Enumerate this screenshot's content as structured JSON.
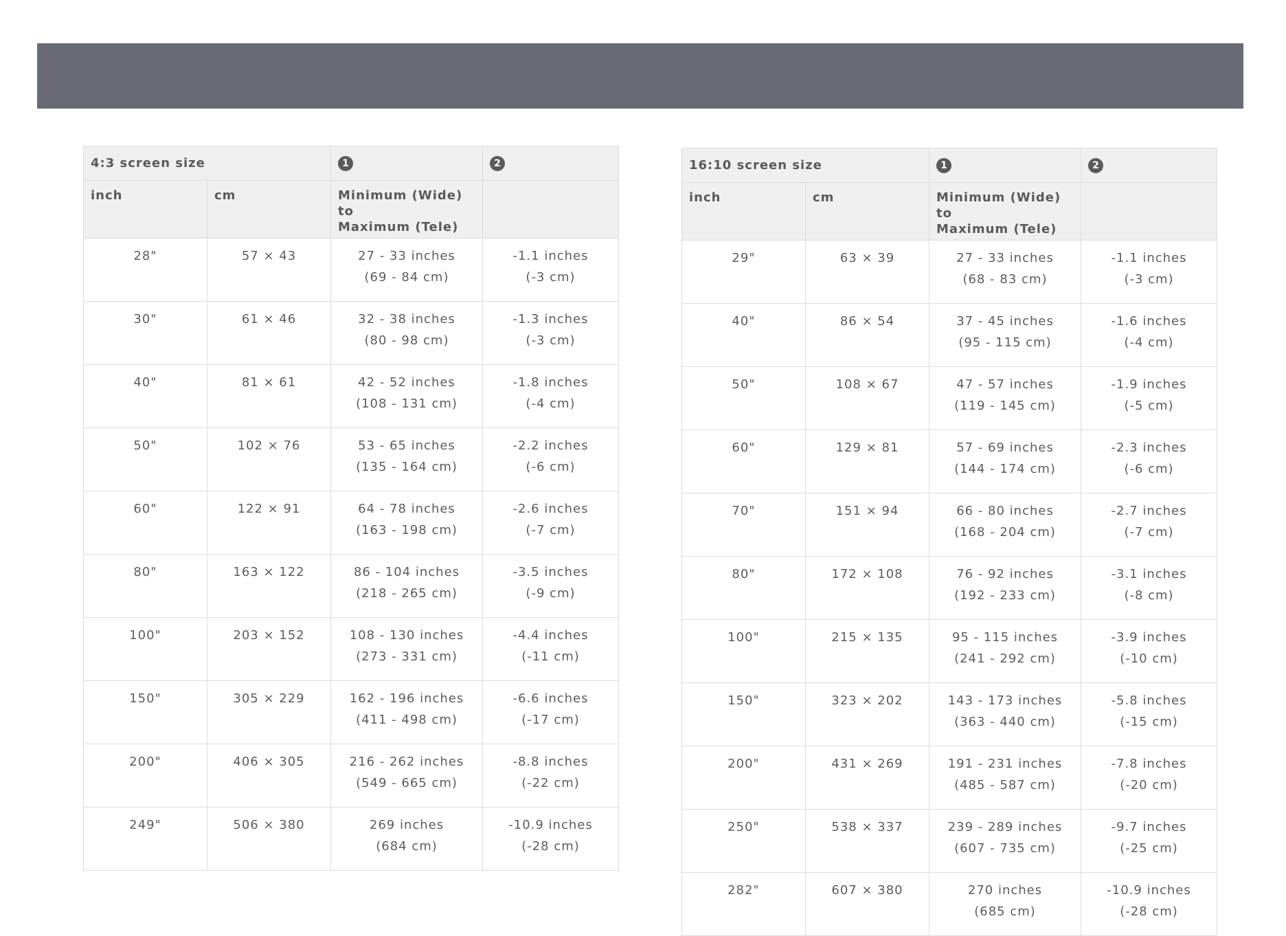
{
  "tables": [
    {
      "title": "4:3 screen size",
      "icons": {
        "col3": "1",
        "col4": "2"
      },
      "col_inch": "inch",
      "col_cm": "cm",
      "col_range_line1": "Minimum (Wide) to",
      "col_range_line2": "Maximum (Tele)",
      "rows": [
        {
          "inch": "28\"",
          "cm": "57 × 43",
          "range": "27 - 33 inches",
          "range_cm": "(69 - 84 cm)",
          "offset": "-1.1 inches",
          "offset_cm": "(-3 cm)"
        },
        {
          "inch": "30\"",
          "cm": "61 × 46",
          "range": "32 - 38 inches",
          "range_cm": "(80 - 98 cm)",
          "offset": "-1.3 inches",
          "offset_cm": "(-3 cm)"
        },
        {
          "inch": "40\"",
          "cm": "81 × 61",
          "range": "42 - 52 inches",
          "range_cm": "(108 - 131 cm)",
          "offset": "-1.8 inches",
          "offset_cm": "(-4 cm)"
        },
        {
          "inch": "50\"",
          "cm": "102 × 76",
          "range": "53 - 65 inches",
          "range_cm": "(135 - 164 cm)",
          "offset": "-2.2 inches",
          "offset_cm": "(-6 cm)"
        },
        {
          "inch": "60\"",
          "cm": "122 × 91",
          "range": "64 - 78 inches",
          "range_cm": "(163 - 198 cm)",
          "offset": "-2.6 inches",
          "offset_cm": "(-7 cm)"
        },
        {
          "inch": "80\"",
          "cm": "163 × 122",
          "range": "86 - 104 inches",
          "range_cm": "(218 - 265 cm)",
          "offset": "-3.5 inches",
          "offset_cm": "(-9 cm)"
        },
        {
          "inch": "100\"",
          "cm": "203 × 152",
          "range": "108 - 130 inches",
          "range_cm": "(273 - 331 cm)",
          "offset": "-4.4 inches",
          "offset_cm": "(-11 cm)"
        },
        {
          "inch": "150\"",
          "cm": "305 × 229",
          "range": "162 - 196 inches",
          "range_cm": "(411 - 498 cm)",
          "offset": "-6.6 inches",
          "offset_cm": "(-17 cm)"
        },
        {
          "inch": "200\"",
          "cm": "406 × 305",
          "range": "216 - 262 inches",
          "range_cm": "(549 - 665 cm)",
          "offset": "-8.8 inches",
          "offset_cm": "(-22 cm)"
        },
        {
          "inch": "249\"",
          "cm": "506 × 380",
          "range": "269 inches",
          "range_cm": "(684 cm)",
          "offset": "-10.9 inches",
          "offset_cm": "(-28 cm)"
        }
      ]
    },
    {
      "title": "16:10 screen size",
      "icons": {
        "col3": "1",
        "col4": "2"
      },
      "col_inch": "inch",
      "col_cm": "cm",
      "col_range_line1": "Minimum (Wide) to",
      "col_range_line2": "Maximum (Tele)",
      "rows": [
        {
          "inch": "29\"",
          "cm": "63 × 39",
          "range": "27 - 33 inches",
          "range_cm": "(68 - 83 cm)",
          "offset": "-1.1 inches",
          "offset_cm": "(-3 cm)"
        },
        {
          "inch": "40\"",
          "cm": "86 × 54",
          "range": "37 - 45 inches",
          "range_cm": "(95 - 115 cm)",
          "offset": "-1.6 inches",
          "offset_cm": "(-4 cm)"
        },
        {
          "inch": "50\"",
          "cm": "108 × 67",
          "range": "47 - 57 inches",
          "range_cm": "(119 - 145 cm)",
          "offset": "-1.9 inches",
          "offset_cm": "(-5 cm)"
        },
        {
          "inch": "60\"",
          "cm": "129 × 81",
          "range": "57 - 69 inches",
          "range_cm": "(144 - 174 cm)",
          "offset": "-2.3 inches",
          "offset_cm": "(-6 cm)"
        },
        {
          "inch": "70\"",
          "cm": "151 × 94",
          "range": "66 - 80 inches",
          "range_cm": "(168 - 204 cm)",
          "offset": "-2.7 inches",
          "offset_cm": "(-7 cm)"
        },
        {
          "inch": "80\"",
          "cm": "172 × 108",
          "range": "76 - 92 inches",
          "range_cm": "(192 - 233 cm)",
          "offset": "-3.1 inches",
          "offset_cm": "(-8 cm)"
        },
        {
          "inch": "100\"",
          "cm": "215 × 135",
          "range": "95 - 115 inches",
          "range_cm": "(241 - 292 cm)",
          "offset": "-3.9 inches",
          "offset_cm": "(-10 cm)"
        },
        {
          "inch": "150\"",
          "cm": "323 × 202",
          "range": "143 - 173 inches",
          "range_cm": "(363 - 440 cm)",
          "offset": "-5.8 inches",
          "offset_cm": "(-15 cm)"
        },
        {
          "inch": "200\"",
          "cm": "431 × 269",
          "range": "191 - 231 inches",
          "range_cm": "(485 - 587 cm)",
          "offset": "-7.8 inches",
          "offset_cm": "(-20 cm)"
        },
        {
          "inch": "250\"",
          "cm": "538 × 337",
          "range": "239 - 289 inches",
          "range_cm": "(607 - 735 cm)",
          "offset": "-9.7 inches",
          "offset_cm": "(-25 cm)"
        },
        {
          "inch": "282\"",
          "cm": "607 × 380",
          "range": "270 inches",
          "range_cm": "(685 cm)",
          "offset": "-10.9 inches",
          "offset_cm": "(-28 cm)"
        }
      ]
    }
  ]
}
